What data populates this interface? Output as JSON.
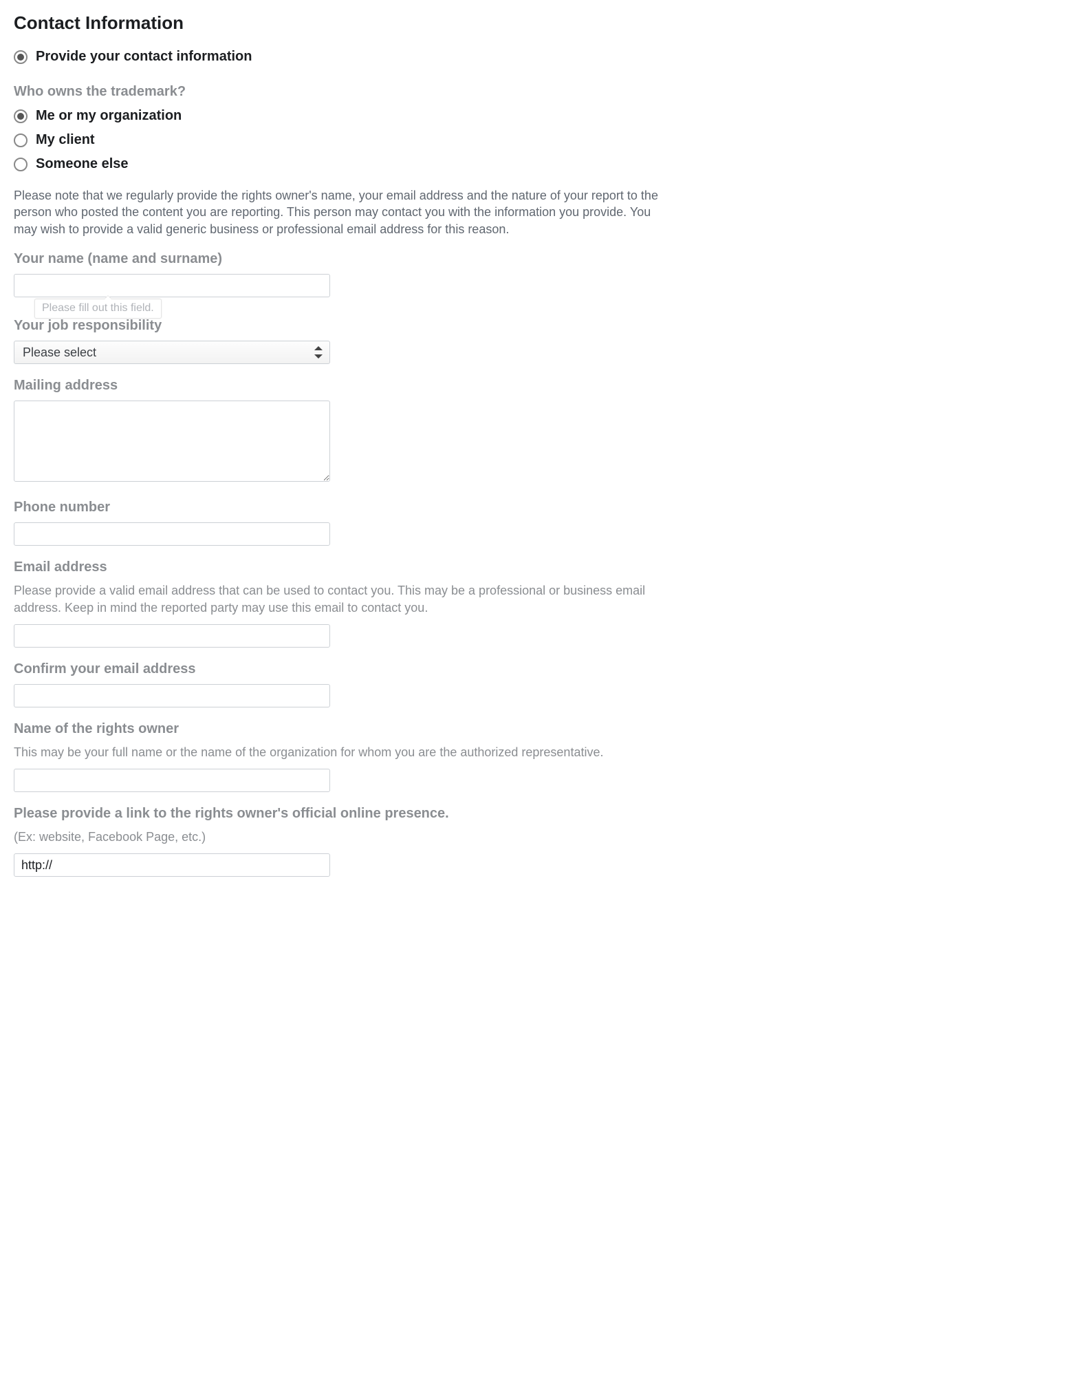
{
  "section": {
    "title": "Contact Information"
  },
  "contact_option": {
    "label": "Provide your contact information"
  },
  "ownership": {
    "question": "Who owns the trademark?",
    "options": {
      "self": "Me or my organization",
      "client": "My client",
      "other": "Someone else"
    }
  },
  "disclosure_note": "Please note that we regularly provide the rights owner's name, your email address and the nature of your report to the person who posted the content you are reporting. This person may contact you with the information you provide. You may wish to provide a valid generic business or professional email address for this reason.",
  "name_field": {
    "label": "Your name (name and surname)",
    "validation": "Please fill out this field."
  },
  "job_field": {
    "label": "Your job responsibility",
    "placeholder": "Please select"
  },
  "mailing_field": {
    "label": "Mailing address"
  },
  "phone_field": {
    "label": "Phone number"
  },
  "email_field": {
    "label": "Email address",
    "helper": "Please provide a valid email address that can be used to contact you. This may be a professional or business email address. Keep in mind the reported party may use this email to contact you."
  },
  "confirm_email_field": {
    "label": "Confirm your email address"
  },
  "rights_owner_field": {
    "label": "Name of the rights owner",
    "helper": "This may be your full name or the name of the organization for whom you are the authorized representative."
  },
  "link_field": {
    "label": "Please provide a link to the rights owner's official online presence.",
    "helper": "(Ex: website, Facebook Page, etc.)",
    "value": "http://"
  }
}
